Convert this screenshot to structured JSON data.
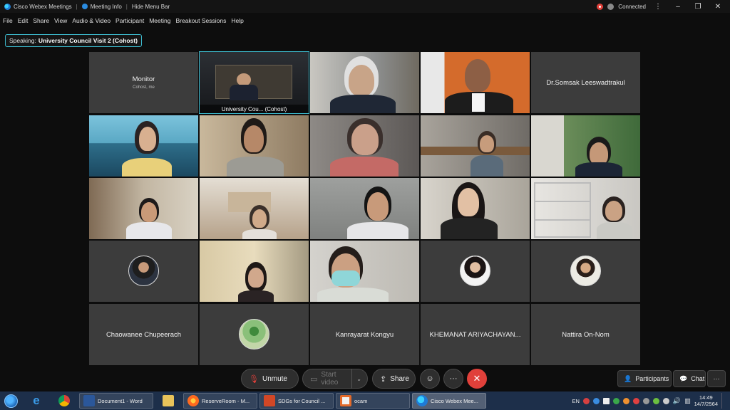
{
  "window": {
    "app_title": "Cisco Webex Meetings",
    "meeting_info": "Meeting Info",
    "hide_menu_bar": "Hide Menu Bar",
    "status": "Connected"
  },
  "menu": [
    "File",
    "Edit",
    "Share",
    "View",
    "Audio & Video",
    "Participant",
    "Meeting",
    "Breakout Sessions",
    "Help"
  ],
  "speaking": {
    "prefix": "Speaking:",
    "name": "University Council Visit 2 (Cohost)"
  },
  "tiles": {
    "monitor": {
      "name": "Monitor",
      "sub": "Cohost, me"
    },
    "university_council": {
      "label": "University Cou... (Cohost)"
    },
    "somsak": {
      "name": "Dr.Somsak Leeswadtrakul"
    },
    "chaowanee": {
      "name": "Chaowanee Chupeerach"
    },
    "kanrayarat": {
      "name": "Kanrayarat Kongyu"
    },
    "khemanat": {
      "name": "KHEMANAT ARIYACHAYAN..."
    },
    "nattira": {
      "name": "Nattira On-Nom"
    }
  },
  "controls": {
    "unmute": "Unmute",
    "start_video": "Start video",
    "share": "Share",
    "participants": "Participants",
    "chat": "Chat"
  },
  "taskbar": {
    "apps": [
      "Document1 - Word",
      "ReserveRoom - M...",
      "SDGs for Council ...",
      "ocam",
      "Cisco Webex Mee..."
    ],
    "lang": "EN",
    "time": "14:49",
    "date": "14/7/2564"
  },
  "colors": {
    "accent": "#3bb6c9",
    "leave": "#e0403a",
    "tile_bg": "#3c3c3c",
    "taskbar": "#1d2f4a"
  }
}
